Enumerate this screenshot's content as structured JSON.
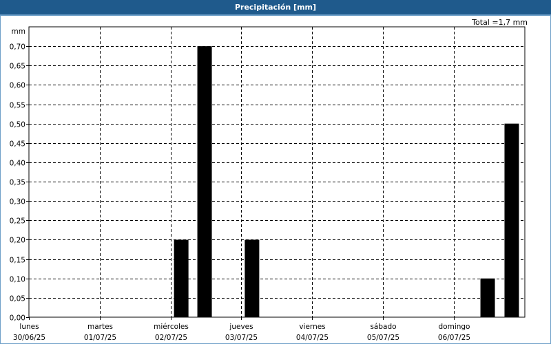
{
  "chart_data": {
    "type": "bar",
    "title": "Precipitación [mm]",
    "ylabel": "mm",
    "total_label": "Total =1,7 mm",
    "ylim": [
      0,
      0.75
    ],
    "yticks": [
      "0,00",
      "0,05",
      "0,10",
      "0,15",
      "0,20",
      "0,25",
      "0,30",
      "0,35",
      "0,40",
      "0,45",
      "0,50",
      "0,55",
      "0,60",
      "0,65",
      "0,70"
    ],
    "x_days": [
      {
        "day": "lunes",
        "date": "30/06/25"
      },
      {
        "day": "martes",
        "date": "01/07/25"
      },
      {
        "day": "miércoles",
        "date": "02/07/25"
      },
      {
        "day": "jueves",
        "date": "03/07/25"
      },
      {
        "day": "viernes",
        "date": "04/07/25"
      },
      {
        "day": "sábado",
        "date": "05/07/25"
      },
      {
        "day": "domingo",
        "date": "06/07/25"
      }
    ],
    "bars": [
      {
        "day_offset": 2.05,
        "value": 0.2
      },
      {
        "day_offset": 2.38,
        "value": 0.7
      },
      {
        "day_offset": 3.05,
        "value": 0.2
      },
      {
        "day_offset": 6.38,
        "value": 0.1
      },
      {
        "day_offset": 6.72,
        "value": 0.5
      }
    ],
    "grid": true,
    "bar_color": "#000000",
    "grid_color": "#000000"
  }
}
